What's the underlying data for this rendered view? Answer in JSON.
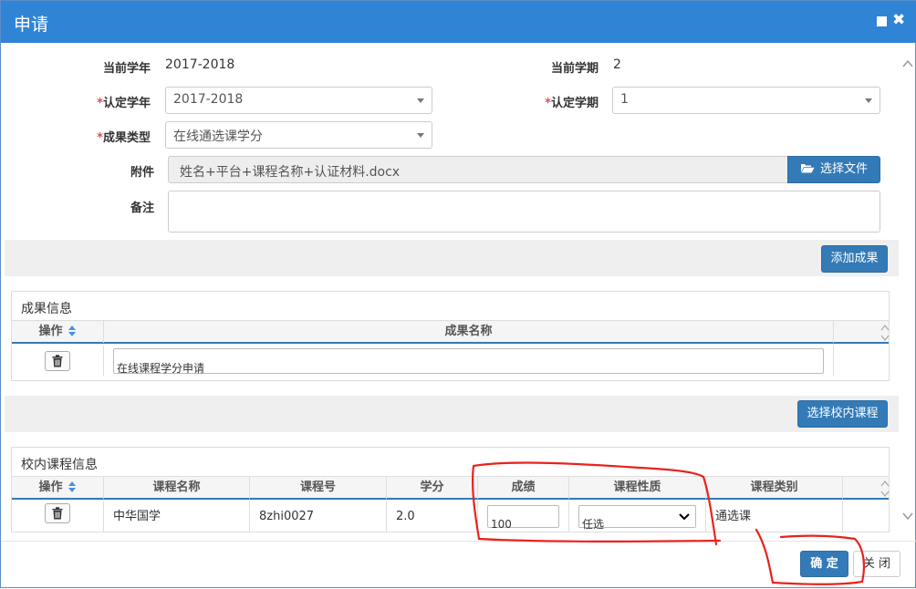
{
  "dialog": {
    "title": "申请",
    "max_icon": "maximize-icon",
    "close_icon": "close-icon"
  },
  "form": {
    "current_year_label": "当前学年",
    "current_year_value": "2017-2018",
    "current_term_label": "当前学期",
    "current_term_value": "2",
    "required_mark": "*",
    "recog_year_label": "认定学年",
    "recog_year_value": "2017-2018",
    "recog_term_label": "认定学期",
    "recog_term_value": "1",
    "result_type_label": "成果类型",
    "result_type_value": "在线通选课学分",
    "attachment_label": "附件",
    "attachment_value": "姓名+平台+课程名称+认证材料.docx",
    "choose_file_label": "选择文件",
    "note_label": "备注",
    "note_value": ""
  },
  "add_result_button": "添加成果",
  "results_panel": {
    "title": "成果信息",
    "headers": [
      "操作",
      "成果名称"
    ],
    "rows": [
      {
        "name": "在线课程学分申请"
      }
    ]
  },
  "choose_course_button": "选择校内课程",
  "courses_panel": {
    "title": "校内课程信息",
    "headers": [
      "操作",
      "课程名称",
      "课程号",
      "学分",
      "成绩",
      "课程性质",
      "课程类别"
    ],
    "rows": [
      {
        "course_name": "中华国学",
        "course_no": "8zhi0027",
        "credit": "2.0",
        "score": "100",
        "nature": "任选",
        "category": "通选课"
      }
    ]
  },
  "footer": {
    "confirm_label": "确 定",
    "close_label": "关 闭"
  },
  "colors": {
    "titlebar": "#2f84d6",
    "primary_button": "#337ab7",
    "annotation": "#e8231f"
  }
}
